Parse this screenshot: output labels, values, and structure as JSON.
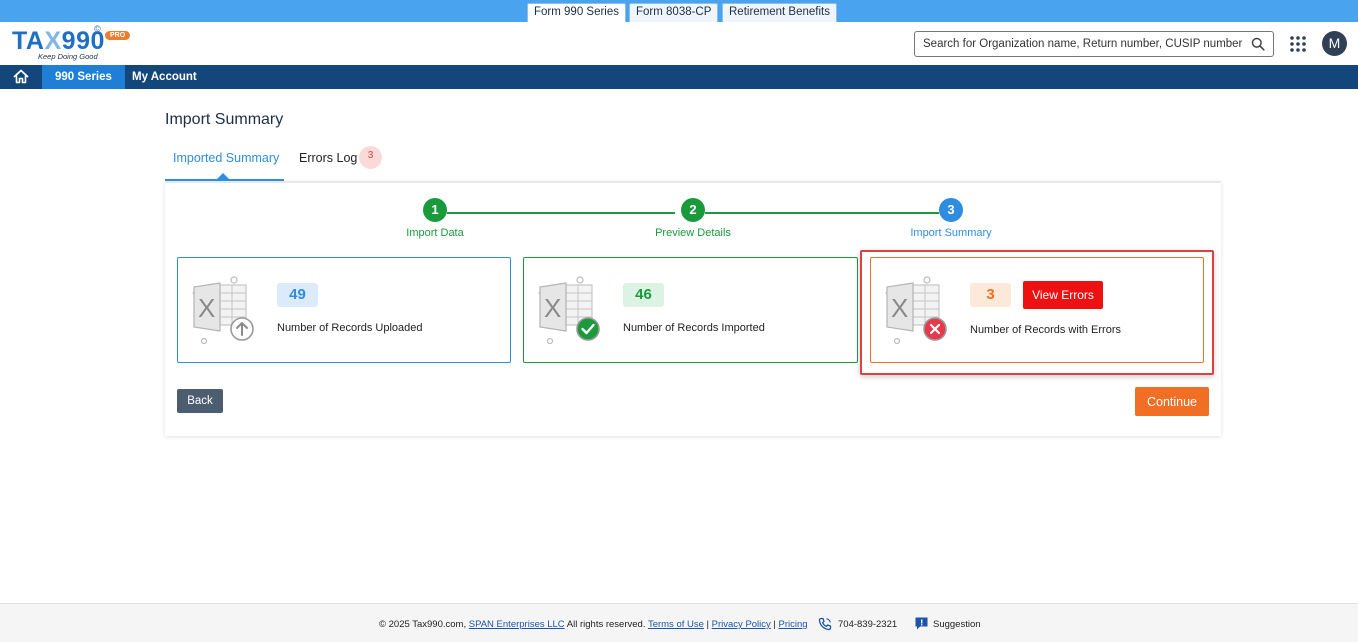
{
  "product_tabs": [
    "Form 990 Series",
    "Form 8038-CP",
    "Retirement Benefits"
  ],
  "logo": {
    "text_a": "TA",
    "text_x": "X",
    "text_b": "990",
    "reg": "©",
    "badge": "PRO",
    "tagline": "Keep Doing Good"
  },
  "search": {
    "placeholder": "Search for Organization name, Return number, CUSIP number"
  },
  "user": {
    "initial": "M"
  },
  "nav": {
    "items": [
      "990 Series",
      "My Account"
    ]
  },
  "page": {
    "title": "Import Summary"
  },
  "tabs": {
    "imported": "Imported Summary",
    "errors": "Errors Log",
    "errors_count": "3"
  },
  "stepper": {
    "steps": [
      {
        "number": "1",
        "label": "Import Data",
        "status": "complete"
      },
      {
        "number": "2",
        "label": "Preview Details",
        "status": "complete"
      },
      {
        "number": "3",
        "label": "Import Summary",
        "status": "current"
      }
    ]
  },
  "cards": [
    {
      "count": "49",
      "label": "Number of Records Uploaded",
      "accent": "#2d8de0",
      "badge_bg": "#dcebfb"
    },
    {
      "count": "46",
      "label": "Number of Records Imported",
      "accent": "#1b9a3c",
      "badge_bg": "#dcf3e3"
    },
    {
      "count": "3",
      "label": "Number of Records with Errors",
      "accent": "#f06f24",
      "badge_bg": "#fde9d9",
      "action": "View Errors"
    }
  ],
  "buttons": {
    "back": "Back",
    "continue": "Continue"
  },
  "footer": {
    "copyright": "© 2025 Tax990.com,",
    "company": "SPAN Enterprises LLC",
    "rights": "All rights reserved.",
    "terms": "Terms of Use",
    "privacy": "Privacy Policy",
    "pricing": "Pricing",
    "phone": "704-839-2321",
    "suggestion": "Suggestion"
  },
  "colors": {
    "brand_blue": "#1f6fc2",
    "nav_bg": "#13467a",
    "success": "#1b9a3c",
    "error": "#ee1111",
    "orange": "#f06f24"
  }
}
